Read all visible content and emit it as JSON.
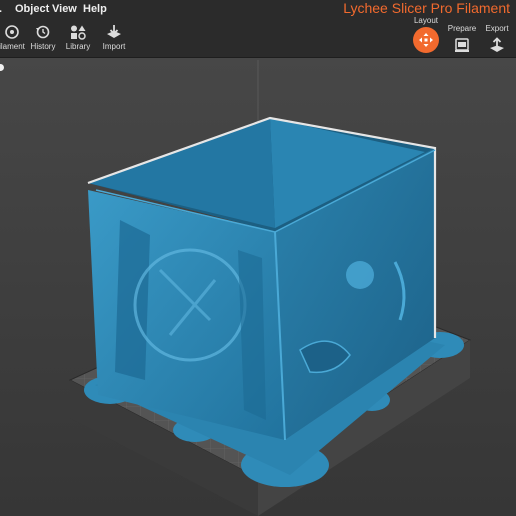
{
  "menu": {
    "items": [
      {
        "label": "Object"
      },
      {
        "label": "View"
      },
      {
        "label": "Help"
      }
    ]
  },
  "app_title": "Lychee Slicer Pro Filament",
  "toolbar": {
    "tools": [
      {
        "label": "ilament",
        "icon": "filament-spool-icon"
      },
      {
        "label": "History",
        "icon": "history-icon"
      },
      {
        "label": "Library",
        "icon": "library-shapes-icon"
      },
      {
        "label": "Import",
        "icon": "import-icon"
      }
    ]
  },
  "modes": [
    {
      "label": "Layout",
      "icon": "move-arrows-icon",
      "active": true
    },
    {
      "label": "Prepare",
      "icon": "printer-icon",
      "active": false
    },
    {
      "label": "Export",
      "icon": "export-icon",
      "active": false
    }
  ],
  "colors": {
    "accent": "#f26a2e",
    "model": "#2f8bb8",
    "plate": "#5a5a5a",
    "background": "#3f3f3f"
  }
}
